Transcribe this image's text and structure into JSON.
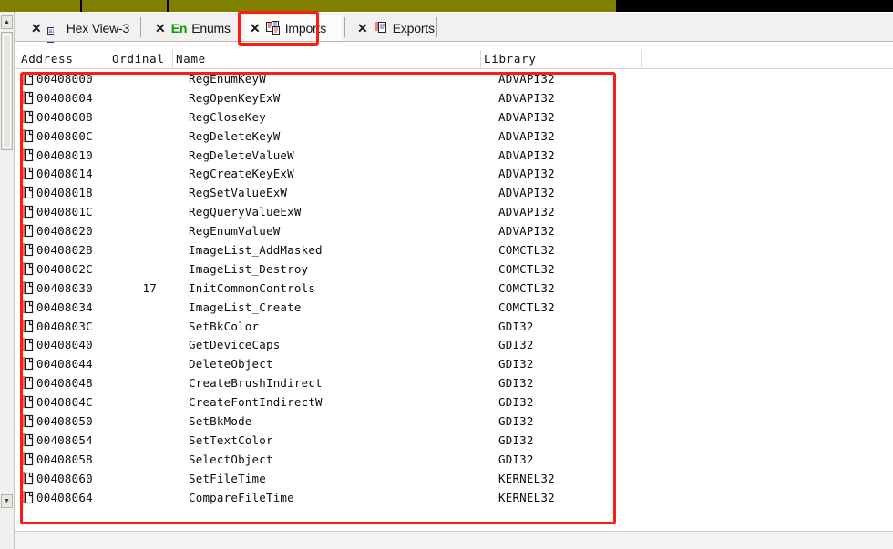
{
  "window": {
    "topband_color": "#808000",
    "topband_dark_color": "#000000",
    "annotation_color": "#fc1c12"
  },
  "tabs": {
    "close_glyph": "✕",
    "items": [
      {
        "label": "Hex View-3",
        "icon": "hex-view-icon",
        "active": false
      },
      {
        "label": "Enums",
        "prefix": "En",
        "icon": "enums-icon",
        "active": false
      },
      {
        "label": "Imports",
        "icon": "imports-icon",
        "active": true
      },
      {
        "label": "Exports",
        "icon": "exports-icon",
        "active": false
      }
    ]
  },
  "scrollbar": {
    "up_arrow": "▲",
    "down_arrow": "▼"
  },
  "table": {
    "columns": [
      "Address",
      "Ordinal",
      "Name",
      "Library"
    ],
    "rows": [
      {
        "address": "00408000",
        "ordinal": "",
        "name": "RegEnumKeyW",
        "library": "ADVAPI32"
      },
      {
        "address": "00408004",
        "ordinal": "",
        "name": "RegOpenKeyExW",
        "library": "ADVAPI32"
      },
      {
        "address": "00408008",
        "ordinal": "",
        "name": "RegCloseKey",
        "library": "ADVAPI32"
      },
      {
        "address": "0040800C",
        "ordinal": "",
        "name": "RegDeleteKeyW",
        "library": "ADVAPI32"
      },
      {
        "address": "00408010",
        "ordinal": "",
        "name": "RegDeleteValueW",
        "library": "ADVAPI32"
      },
      {
        "address": "00408014",
        "ordinal": "",
        "name": "RegCreateKeyExW",
        "library": "ADVAPI32"
      },
      {
        "address": "00408018",
        "ordinal": "",
        "name": "RegSetValueExW",
        "library": "ADVAPI32"
      },
      {
        "address": "0040801C",
        "ordinal": "",
        "name": "RegQueryValueExW",
        "library": "ADVAPI32"
      },
      {
        "address": "00408020",
        "ordinal": "",
        "name": "RegEnumValueW",
        "library": "ADVAPI32"
      },
      {
        "address": "00408028",
        "ordinal": "",
        "name": "ImageList_AddMasked",
        "library": "COMCTL32"
      },
      {
        "address": "0040802C",
        "ordinal": "",
        "name": "ImageList_Destroy",
        "library": "COMCTL32"
      },
      {
        "address": "00408030",
        "ordinal": "17",
        "name": "InitCommonControls",
        "library": "COMCTL32"
      },
      {
        "address": "00408034",
        "ordinal": "",
        "name": "ImageList_Create",
        "library": "COMCTL32"
      },
      {
        "address": "0040803C",
        "ordinal": "",
        "name": "SetBkColor",
        "library": "GDI32"
      },
      {
        "address": "00408040",
        "ordinal": "",
        "name": "GetDeviceCaps",
        "library": "GDI32"
      },
      {
        "address": "00408044",
        "ordinal": "",
        "name": "DeleteObject",
        "library": "GDI32"
      },
      {
        "address": "00408048",
        "ordinal": "",
        "name": "CreateBrushIndirect",
        "library": "GDI32"
      },
      {
        "address": "0040804C",
        "ordinal": "",
        "name": "CreateFontIndirectW",
        "library": "GDI32"
      },
      {
        "address": "00408050",
        "ordinal": "",
        "name": "SetBkMode",
        "library": "GDI32"
      },
      {
        "address": "00408054",
        "ordinal": "",
        "name": "SetTextColor",
        "library": "GDI32"
      },
      {
        "address": "00408058",
        "ordinal": "",
        "name": "SelectObject",
        "library": "GDI32"
      },
      {
        "address": "00408060",
        "ordinal": "",
        "name": "SetFileTime",
        "library": "KERNEL32"
      },
      {
        "address": "00408064",
        "ordinal": "",
        "name": "CompareFileTime",
        "library": "KERNEL32"
      }
    ]
  }
}
